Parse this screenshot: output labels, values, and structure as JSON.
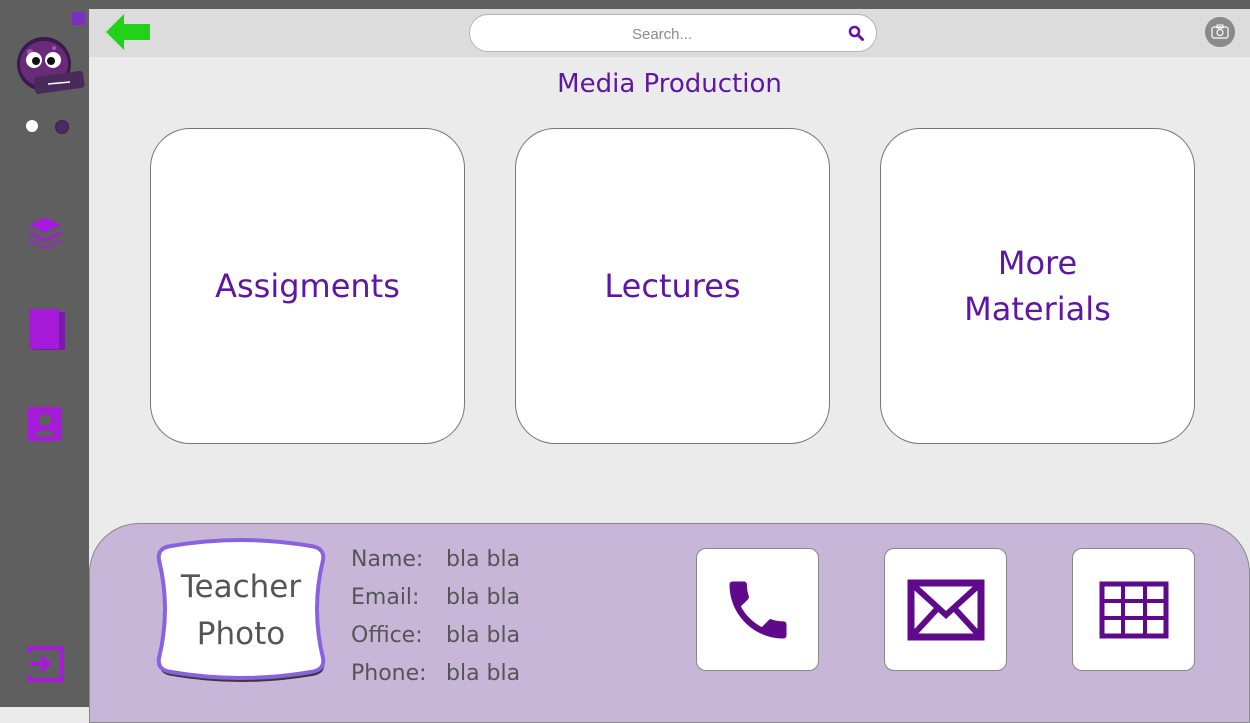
{
  "search": {
    "placeholder": "Search..."
  },
  "page": {
    "title": "Media Production"
  },
  "cards": [
    {
      "label": "Assigments"
    },
    {
      "label": "Lectures"
    },
    {
      "label": "More\nMaterials"
    }
  ],
  "teacher": {
    "photo_text": "Teacher\nPhoto",
    "fields": [
      {
        "label": "Name:",
        "value": "bla bla"
      },
      {
        "label": "Email:",
        "value": "bla bla"
      },
      {
        "label": "Office:",
        "value": "bla bla"
      },
      {
        "label": "Phone:",
        "value": "bla bla"
      }
    ]
  },
  "icons": {
    "back": "arrow-left-icon",
    "search": "search-icon",
    "camera": "camera-icon",
    "layers": "layers-icon",
    "pages": "pages-icon",
    "profile": "profile-icon",
    "logout": "logout-icon",
    "phone": "phone-icon",
    "mail": "mail-icon",
    "calendar": "grid-calendar-icon"
  },
  "colors": {
    "accent": "#5f16a3",
    "back_arrow": "#22d219",
    "sidebar": "#5f5f5f",
    "bottom_panel": "#c8b6d9"
  }
}
